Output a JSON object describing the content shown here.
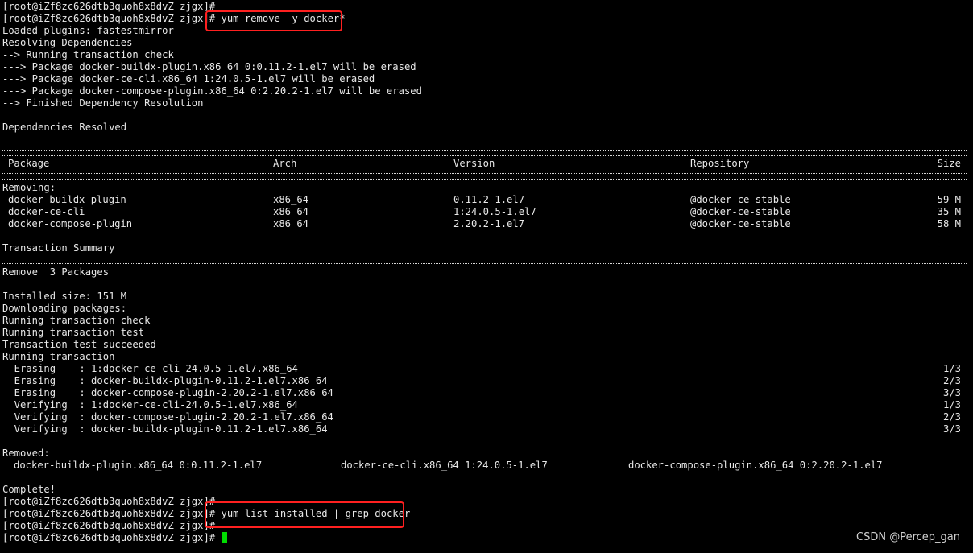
{
  "terminal": {
    "top_prompt": "[root@iZf8zc626dtb3quoh8x8dvZ zjgx]#",
    "prompt": "[root@iZf8zc626dtb3quoh8x8dvZ zjgx]#",
    "command_remove": "yum remove -y docker*",
    "loaded_plugins": "Loaded plugins: fastestmirror",
    "resolving": "Resolving Dependencies",
    "running_check": "--> Running transaction check",
    "pkg_lines": [
      "---> Package docker-buildx-plugin.x86_64 0:0.11.2-1.el7 will be erased",
      "---> Package docker-ce-cli.x86_64 1:24.0.5-1.el7 will be erased",
      "---> Package docker-compose-plugin.x86_64 0:2.20.2-1.el7 will be erased"
    ],
    "finished": "--> Finished Dependency Resolution",
    "deps_resolved": "Dependencies Resolved",
    "table": {
      "headers": [
        "Package",
        "Arch",
        "Version",
        "Repository",
        "Size"
      ],
      "section": "Removing:",
      "rows": [
        [
          "docker-buildx-plugin",
          "x86_64",
          "0.11.2-1.el7",
          "@docker-ce-stable",
          "59 M"
        ],
        [
          "docker-ce-cli",
          "x86_64",
          "1:24.0.5-1.el7",
          "@docker-ce-stable",
          "35 M"
        ],
        [
          "docker-compose-plugin",
          "x86_64",
          "2.20.2-1.el7",
          "@docker-ce-stable",
          "58 M"
        ]
      ]
    },
    "transaction_summary": "Transaction Summary",
    "remove_count": "Remove  3 Packages",
    "installed_size": "Installed size: 151 M",
    "downloading": "Downloading packages:",
    "running_tx_check": "Running transaction check",
    "running_tx_test": "Running transaction test",
    "tx_test_ok": "Transaction test succeeded",
    "running_tx": "Running transaction",
    "steps": [
      {
        "action": "  Erasing    : 1:docker-ce-cli-24.0.5-1.el7.x86_64",
        "progress": "1/3"
      },
      {
        "action": "  Erasing    : docker-buildx-plugin-0.11.2-1.el7.x86_64",
        "progress": "2/3"
      },
      {
        "action": "  Erasing    : docker-compose-plugin-2.20.2-1.el7.x86_64",
        "progress": "3/3"
      },
      {
        "action": "  Verifying  : 1:docker-ce-cli-24.0.5-1.el7.x86_64",
        "progress": "1/3"
      },
      {
        "action": "  Verifying  : docker-compose-plugin-2.20.2-1.el7.x86_64",
        "progress": "2/3"
      },
      {
        "action": "  Verifying  : docker-buildx-plugin-0.11.2-1.el7.x86_64",
        "progress": "3/3"
      }
    ],
    "removed_label": "Removed:",
    "removed": [
      "docker-buildx-plugin.x86_64 0:0.11.2-1.el7",
      "docker-ce-cli.x86_64 1:24.0.5-1.el7",
      "docker-compose-plugin.x86_64 0:2.20.2-1.el7"
    ],
    "complete": "Complete!",
    "command_list": "yum list installed | grep docker",
    "highlight_color": "#ff2020",
    "cursor_color": "#00dc00"
  },
  "watermark": "CSDN @Percep_gan"
}
